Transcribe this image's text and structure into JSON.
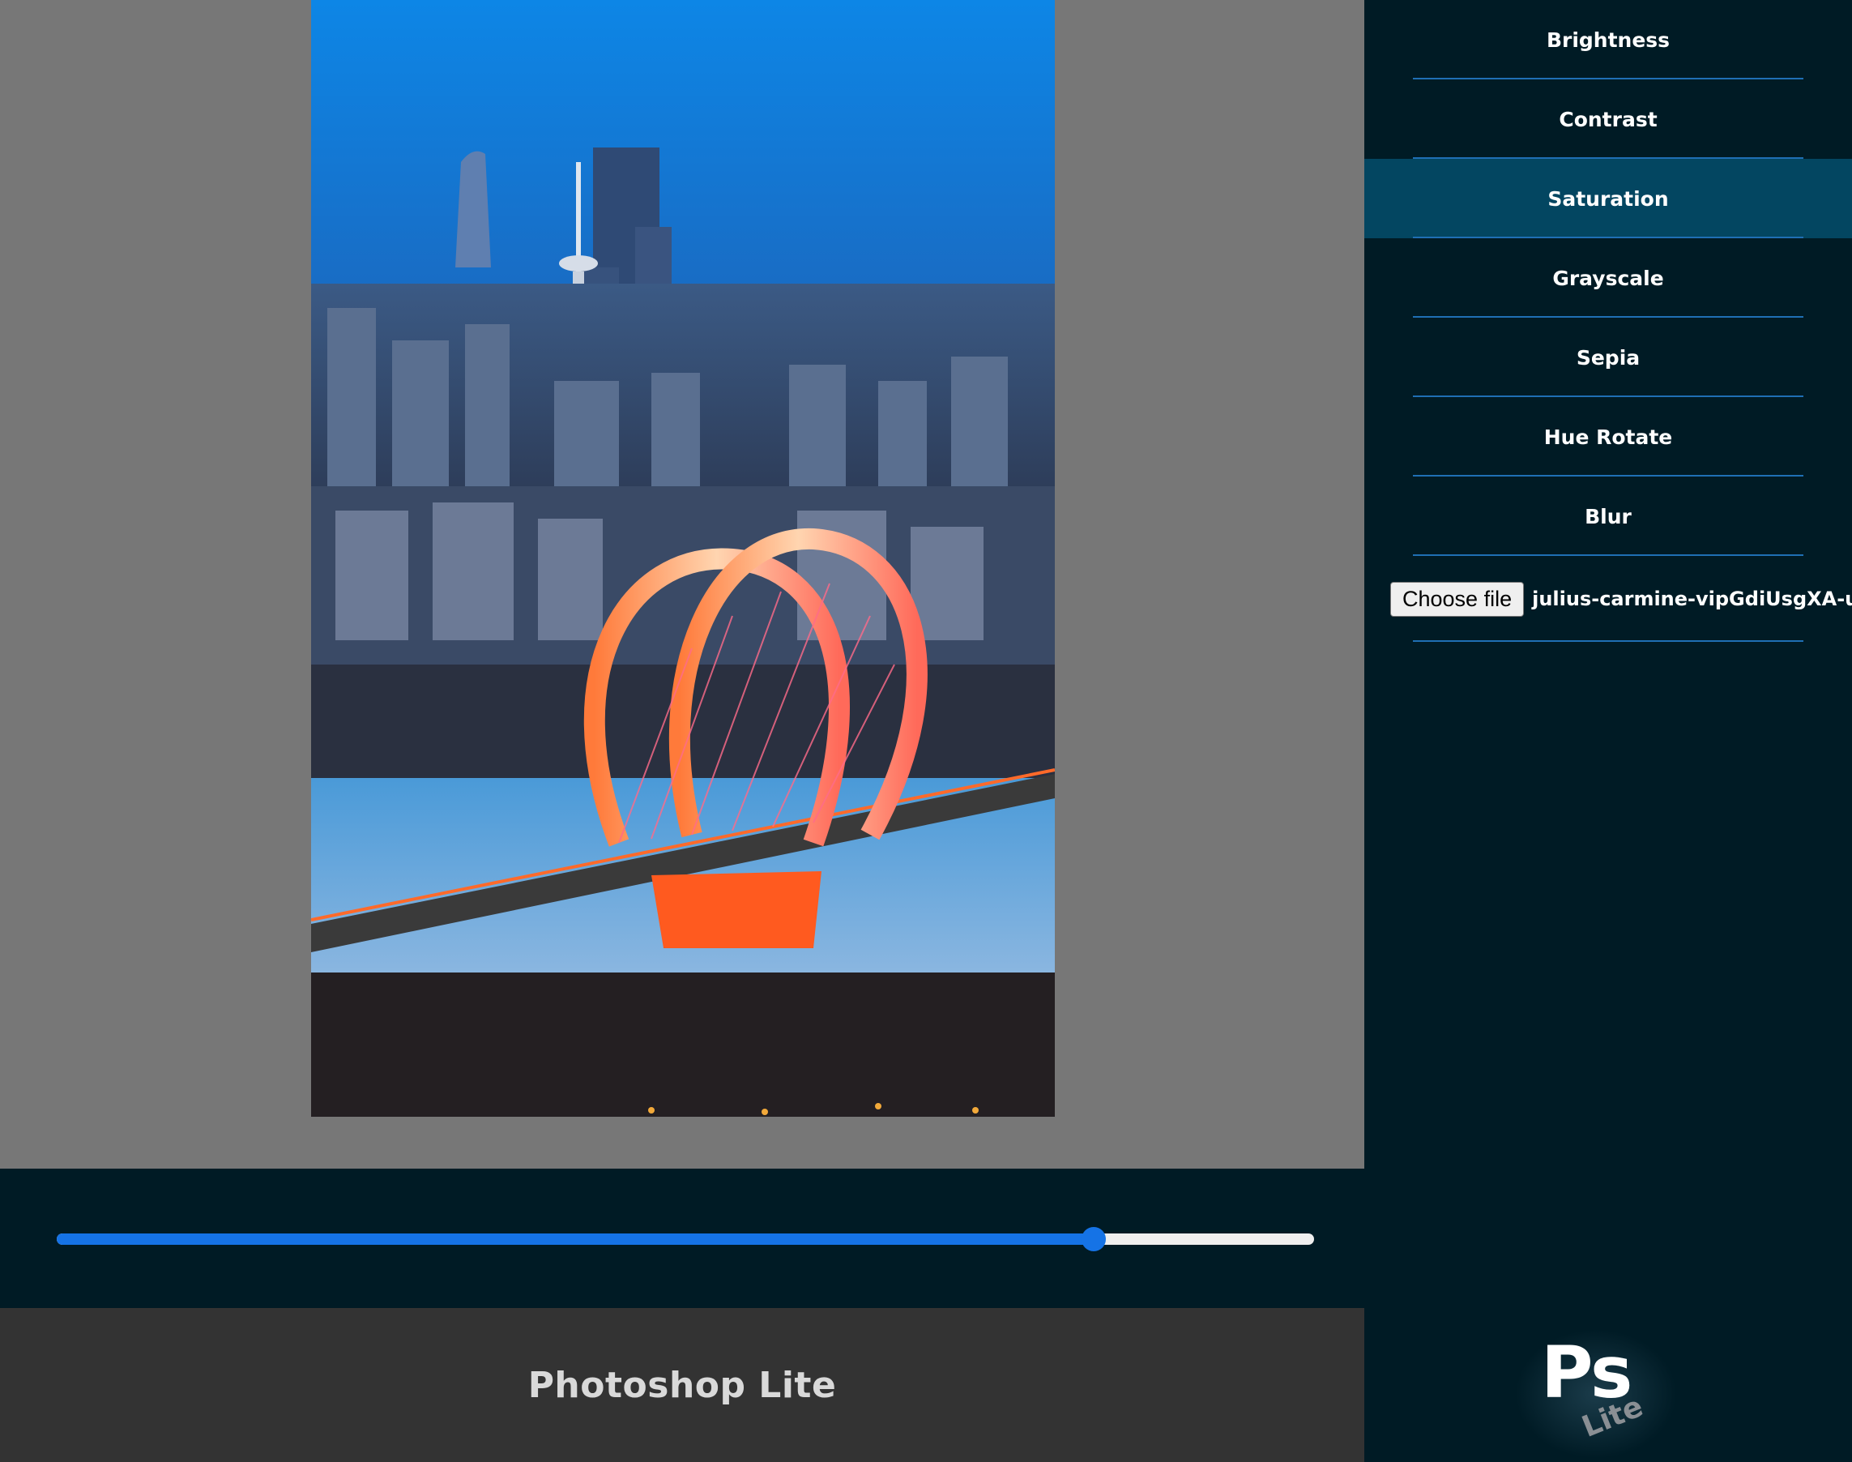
{
  "canvas": {
    "image_alt": "Night city skyline with an illuminated double-arch bridge over a frozen river"
  },
  "slider": {
    "value_fraction": 0.825
  },
  "footer": {
    "title": "Photoshop Lite"
  },
  "tools": [
    {
      "label": "Brightness",
      "active": false
    },
    {
      "label": "Contrast",
      "active": false
    },
    {
      "label": "Saturation",
      "active": true
    },
    {
      "label": "Grayscale",
      "active": false
    },
    {
      "label": "Sepia",
      "active": false
    },
    {
      "label": "Hue Rotate",
      "active": false
    },
    {
      "label": "Blur",
      "active": false
    }
  ],
  "file_input": {
    "button_label": "Choose file",
    "file_name": "julius-carmine-vipGdiUsgXA-unsp"
  },
  "logo": {
    "main": "Ps",
    "sub": "Lite"
  },
  "colors": {
    "accent": "#1573e6",
    "sidebar_bg": "#001b25",
    "active_tool_bg": "#034661",
    "canvas_bg": "#777777",
    "footer_bg": "#333333"
  }
}
